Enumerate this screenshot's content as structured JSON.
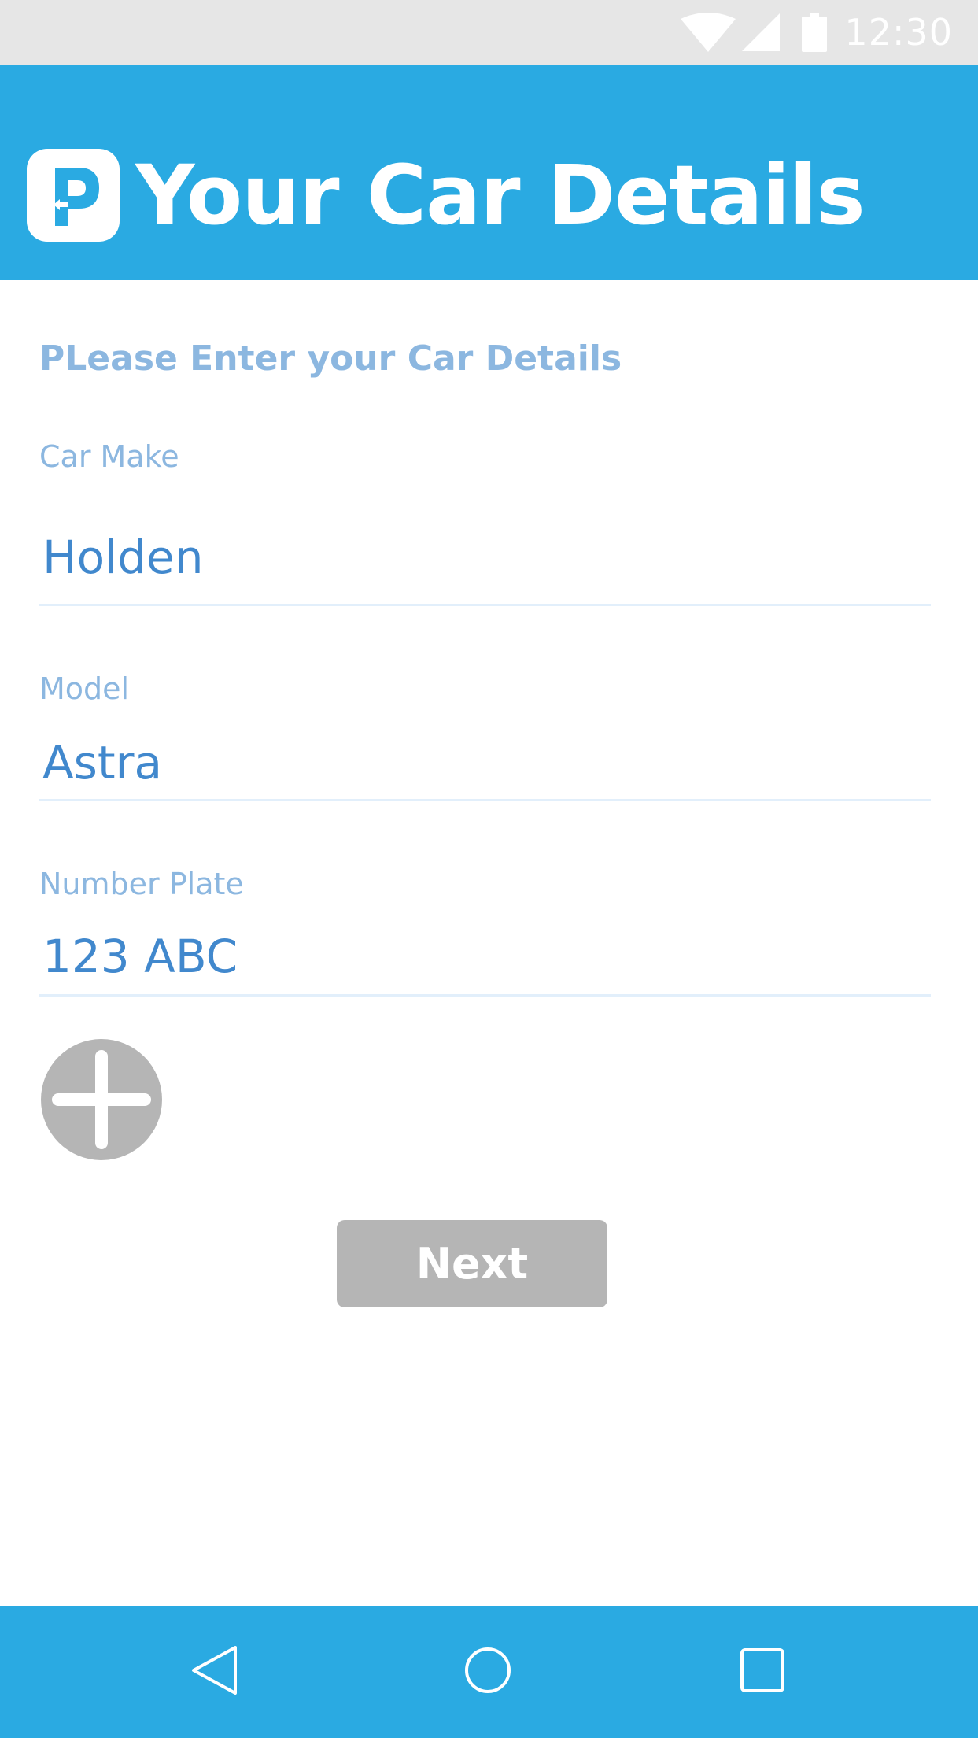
{
  "status_bar": {
    "time": "12:30"
  },
  "header": {
    "title": "Your Car Details",
    "logo_icon": "parking-p-icon"
  },
  "form": {
    "instructions": "PLease Enter your Car Details",
    "car_make": {
      "label": "Car Make",
      "value": "Holden"
    },
    "model": {
      "label": "Model",
      "value": "Astra"
    },
    "number_plate": {
      "label": "Number Plate",
      "value": "123 ABC"
    },
    "add_icon": "plus-icon",
    "next_label": "Next"
  },
  "nav": {
    "back_icon": "back-triangle-icon",
    "home_icon": "home-circle-icon",
    "recent_icon": "recent-square-icon"
  },
  "colors": {
    "primary": "#2aaae2",
    "label": "#8cb7e0",
    "input_text": "#4188cd",
    "button_gray": "#b5b5b5",
    "status_bar": "#e6e6e6"
  }
}
